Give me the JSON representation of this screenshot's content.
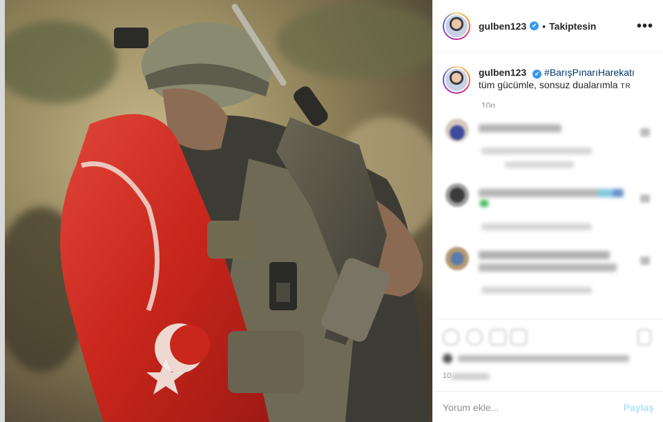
{
  "post": {
    "username": "gulben123",
    "verified_mark": "✔",
    "separator": "•",
    "follow_status": "Takiptesin",
    "more_icon": "•••"
  },
  "caption": {
    "username": "gulben123",
    "hashtag": "#BarışPınarıHarekatı",
    "text": "tüm gücümle, sonsuz dualarımla",
    "flag": "TR",
    "time": "10g"
  },
  "footer": {
    "date": "10",
    "comment_placeholder": "Yorum ekle...",
    "post_label": "Paylaş"
  },
  "colors": {
    "link": "#00376b",
    "verified": "#3897f0",
    "post_disabled": "#b2dffc",
    "flag_red": "#d52b1e"
  }
}
